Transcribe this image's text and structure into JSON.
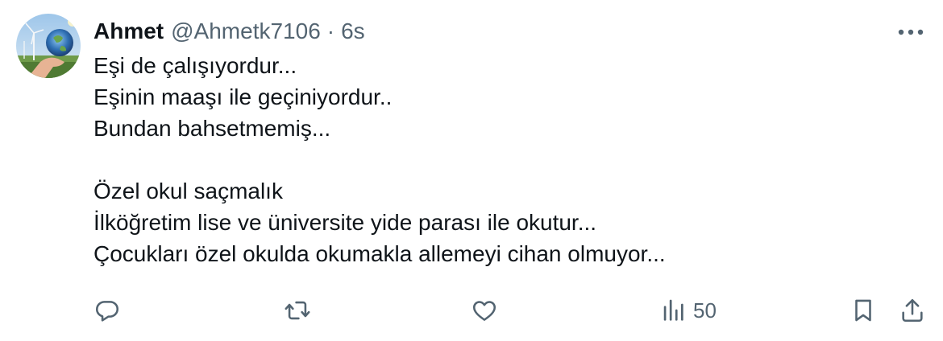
{
  "tweet": {
    "author_name": "Ahmet",
    "handle": "@Ahmetk7106",
    "separator": "·",
    "time": "6s",
    "lines": [
      "Eşi de çalışıyordur...",
      "Eşinin maaşı ile geçiniyordur..",
      "Bundan bahsetmemiş...",
      "",
      "Özel okul saçmalık",
      "İlköğretim lise ve üniversite yide parası ile okutur...",
      "Çocukları özel okulda okumakla allemeyi cihan olmuyor..."
    ]
  },
  "actions": {
    "reply_icon": "reply-bubble-icon",
    "retweet_icon": "retweet-arrows-icon",
    "like_icon": "heart-icon",
    "views_icon": "bar-chart-icon",
    "views_count": "50",
    "bookmark_icon": "bookmark-icon",
    "share_icon": "share-upload-icon",
    "more_icon": "more-dots-icon"
  },
  "colors": {
    "text": "#0f1419",
    "secondary": "#536471",
    "background": "#ffffff"
  }
}
